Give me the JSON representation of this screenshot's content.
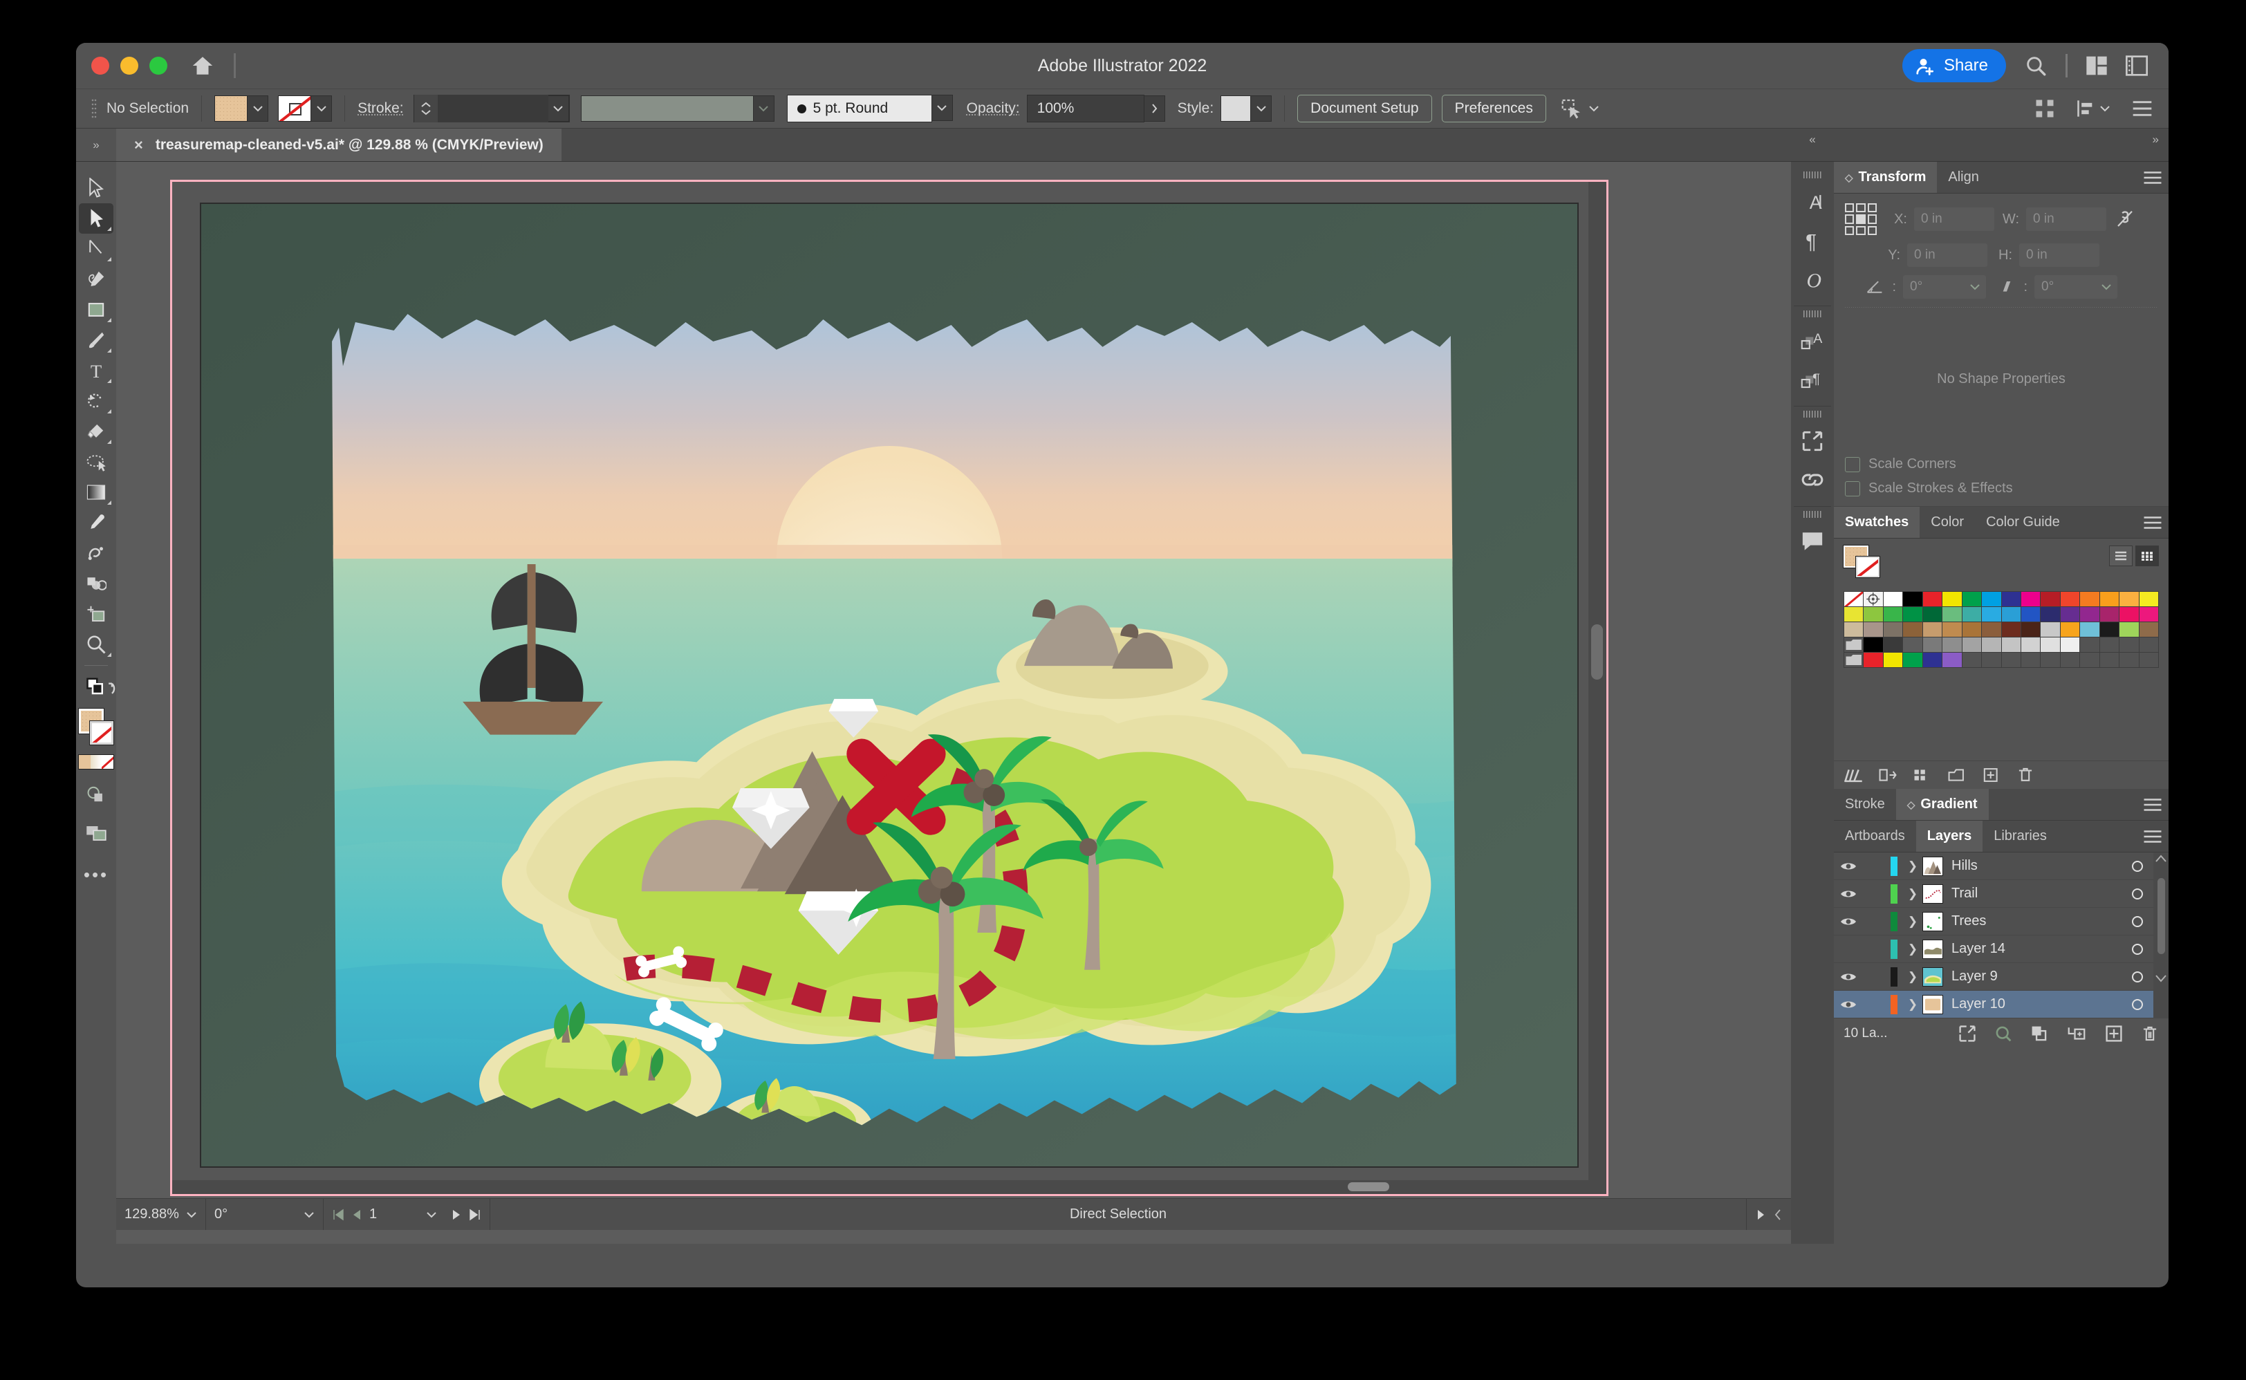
{
  "window": {
    "title": "Adobe Illustrator 2022",
    "share_label": "Share",
    "traffic_lights": [
      "close-button",
      "minimize-button",
      "zoom-button"
    ],
    "icons": [
      "home-icon",
      "search-icon",
      "arrange-documents-icon",
      "workspace-switcher-icon"
    ]
  },
  "controlbar": {
    "selection_state": "No Selection",
    "fill_swatch": "fill-swatch",
    "stroke_swatch": "stroke-swatch-none",
    "stroke_label": "Stroke:",
    "stroke_weight": "",
    "stroke_profile": "",
    "brush_definition": "5 pt. Round",
    "opacity_label": "Opacity:",
    "opacity_value": "100%",
    "style_label": "Style:",
    "document_setup": "Document Setup",
    "preferences": "Preferences"
  },
  "document_tab": {
    "close": "×",
    "title": "treasuremap-cleaned-v5.ai* @ 129.88 % (CMYK/Preview)"
  },
  "toolbar": {
    "tools": [
      {
        "name": "selection-tool",
        "label": "Selection"
      },
      {
        "name": "direct-selection-tool",
        "label": "Direct Selection",
        "active": true
      },
      {
        "name": "pen-tool-group",
        "label": "Pen"
      },
      {
        "name": "curvature-tool",
        "label": "Curvature"
      },
      {
        "name": "rectangle-tool",
        "label": "Rectangle"
      },
      {
        "name": "paintbrush-tool",
        "label": "Paintbrush"
      },
      {
        "name": "type-tool",
        "label": "Type"
      },
      {
        "name": "rotate-tool",
        "label": "Rotate"
      },
      {
        "name": "eraser-tool",
        "label": "Eraser"
      },
      {
        "name": "lasso-tool",
        "label": "Lasso"
      },
      {
        "name": "gradient-tool",
        "label": "Gradient"
      },
      {
        "name": "eyedropper-tool",
        "label": "Eyedropper"
      },
      {
        "name": "blend-tool",
        "label": "Blend"
      },
      {
        "name": "shape-builder-tool",
        "label": "Shape Builder"
      },
      {
        "name": "artboard-tool",
        "label": "Artboard"
      },
      {
        "name": "zoom-tool",
        "label": "Zoom"
      }
    ],
    "more_tools": "•••"
  },
  "statusbar": {
    "zoom_level": "129.88%",
    "rotation": "0°",
    "artboard_number": "1",
    "tool_status": "Direct Selection"
  },
  "right_rail": {
    "items": [
      {
        "name": "character-panel-icon",
        "glyph": "A"
      },
      {
        "name": "paragraph-panel-icon",
        "glyph": "¶"
      },
      {
        "name": "glyphs-panel-icon",
        "glyph": "O"
      },
      {
        "name": "character-styles-icon",
        "glyph": "A"
      },
      {
        "name": "paragraph-styles-icon",
        "glyph": "¶"
      },
      {
        "name": "asset-export-icon",
        "glyph": "↗"
      },
      {
        "name": "links-panel-icon",
        "glyph": "⚭"
      },
      {
        "name": "comments-panel-icon",
        "glyph": "▭"
      }
    ]
  },
  "transform_panel": {
    "tabs": [
      {
        "label": "Transform",
        "active": true
      },
      {
        "label": "Align",
        "active": false
      }
    ],
    "fields": {
      "x_label": "X:",
      "x_value": "0 in",
      "y_label": "Y:",
      "y_value": "0 in",
      "w_label": "W:",
      "w_value": "0 in",
      "h_label": "H:",
      "h_value": "0 in",
      "angle_value": "0°",
      "shear_value": "0°"
    },
    "empty_message": "No Shape Properties",
    "checkboxes": [
      {
        "label": "Scale Corners",
        "checked": false
      },
      {
        "label": "Scale Strokes & Effects",
        "checked": false
      }
    ]
  },
  "swatches_panel": {
    "tabs": [
      {
        "label": "Swatches",
        "active": true
      },
      {
        "label": "Color",
        "active": false
      },
      {
        "label": "Color Guide",
        "active": false
      }
    ],
    "rows": [
      [
        "none",
        "registration",
        "#ffffff",
        "#000000",
        "#e8232a",
        "#f2e500",
        "#00a14b",
        "#00a0e2",
        "#2e3192",
        "#ec008c",
        "#b61d26",
        "#f0452b",
        "#f47b20",
        "#f99f1c",
        "#fbb040",
        "#f4ea21"
      ],
      [
        "#e8e432",
        "#8dc63f",
        "#39b54a",
        "#009245",
        "#006837",
        "#6abd7e",
        "#3dada5",
        "#29abe2",
        "#2a9fd6",
        "#2255c4",
        "#2c2c6e",
        "#662d91",
        "#92278f",
        "#a8246b",
        "#ec1164",
        "#ed187d"
      ],
      [
        "#cdbb9c",
        "#a8958a",
        "#7d7266",
        "#8c6239",
        "#c69c6d",
        "#c08b4f",
        "#a97438",
        "#8b5e3c",
        "#6d2c1e",
        "#4b2418",
        "#c8c8c8",
        "#f7a41d",
        "#6fc0d8",
        "#1b1b1b",
        "#9fd45b",
        "#8e6b4a"
      ],
      [
        "folder",
        "#000000",
        "#3a3a3a",
        "#5c5c5c",
        "#7a7a7a",
        "#8e8e8e",
        "#a3a3a3",
        "#b5b5b5",
        "#c4c4c4",
        "#d2d2d2",
        "#e0e0e0",
        "#efefef",
        "",
        "",
        "",
        ""
      ],
      [
        "folder",
        "#e8232a",
        "#f2e500",
        "#00a14b",
        "#2e3192",
        "#8b5cc6",
        "",
        "",
        "",
        "",
        "",
        "",
        "",
        "",
        "",
        ""
      ]
    ],
    "footer_icons": [
      "swatch-libraries-icon",
      "show-swatch-kinds-icon",
      "swatch-options-icon",
      "new-color-group-icon",
      "new-swatch-icon",
      "delete-swatch-icon"
    ]
  },
  "gradient_panel": {
    "tabs": [
      {
        "label": "Stroke",
        "active": false
      },
      {
        "label": "Gradient",
        "active": true
      }
    ]
  },
  "layers_panel": {
    "tabs": [
      {
        "label": "Artboards",
        "active": false
      },
      {
        "label": "Layers",
        "active": true
      },
      {
        "label": "Libraries",
        "active": false
      }
    ],
    "rows": [
      {
        "name": "Hills",
        "visible": true,
        "color": "#24d6f0",
        "selected": false,
        "thumb": "hills"
      },
      {
        "name": "Trail",
        "visible": true,
        "color": "#4fd24f",
        "selected": false,
        "thumb": "trail"
      },
      {
        "name": "Trees",
        "visible": true,
        "color": "#0f8a3c",
        "selected": false,
        "thumb": "trees"
      },
      {
        "name": "Layer 14",
        "visible": false,
        "color": "#2dbfb0",
        "selected": false,
        "thumb": "layer14"
      },
      {
        "name": "Layer 9",
        "visible": true,
        "color": "#1a1a1a",
        "selected": false,
        "thumb": "layer9"
      },
      {
        "name": "Layer 10",
        "visible": true,
        "color": "#f26322",
        "selected": true,
        "thumb": "layer10"
      }
    ],
    "count_label": "10 La...",
    "footer_icons": [
      "locate-object-icon",
      "make-clipping-mask-icon",
      "create-sublayer-icon",
      "new-layer-icon",
      "delete-layer-icon"
    ]
  },
  "artwork": {
    "title": "treasure-map-illustration",
    "elements": [
      "torn-paper-edge",
      "sky-gradient",
      "sun",
      "ocean-gradient",
      "pirate-ship",
      "main-island",
      "beach-sand",
      "mountains",
      "palm-trees",
      "red-x-marker",
      "diamonds",
      "bones",
      "dashed-trail",
      "small-islands",
      "rocky-islet"
    ],
    "colors": {
      "sky_top": "#a9c4dd",
      "sky_mid": "#d8c7c0",
      "sky_low": "#f0c8a8",
      "sun": "#f7e7c8",
      "ocean_top": "#a8d2b4",
      "ocean_bottom": "#3fb9c6",
      "ocean_deep": "#2f9fc0",
      "sand": "#ece5b0",
      "grass": "#b5d94c",
      "grass_light": "#c8e05e",
      "trail_red": "#b51f35",
      "x_red": "#d11f2d",
      "mountain_dark": "#6e6055",
      "mountain_mid": "#8f7f72",
      "mountain_light": "#b5a392",
      "palm_green": "#1faa4b",
      "palm_green_light": "#41c161",
      "trunk": "#ab9a8d",
      "diamond": "#ffffff",
      "bone": "#ffffff"
    }
  }
}
